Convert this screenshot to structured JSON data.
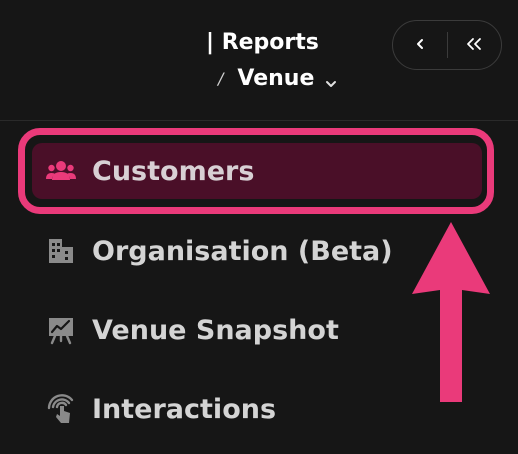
{
  "header": {
    "title": "| Reports",
    "breadcrumb_separator": "/",
    "breadcrumb_current": "Venue"
  },
  "nav": {
    "back_icon": "chevron-left-icon",
    "collapse_icon": "double-chevron-left-icon"
  },
  "menu": {
    "items": [
      {
        "label": "Customers",
        "icon": "users-icon",
        "active": true
      },
      {
        "label": "Organisation (Beta)",
        "icon": "buildings-icon",
        "active": false
      },
      {
        "label": "Venue Snapshot",
        "icon": "chart-board-icon",
        "active": false
      },
      {
        "label": "Interactions",
        "icon": "touch-signal-icon",
        "active": false
      }
    ]
  },
  "colors": {
    "background": "#161616",
    "accent": "#ea3a7a",
    "active_bg": "#4a0f28",
    "text": "#d4d4d4"
  }
}
